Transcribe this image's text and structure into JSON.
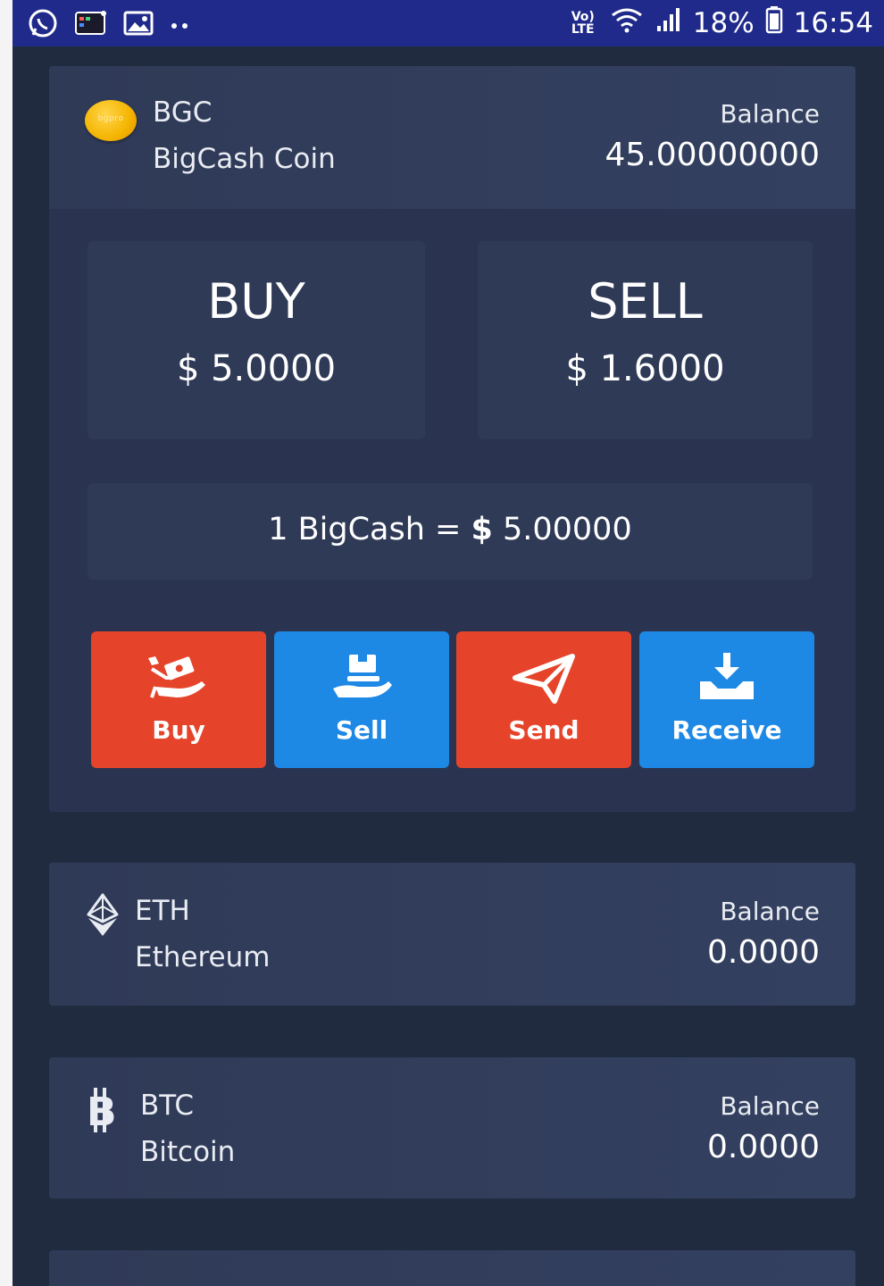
{
  "status_bar": {
    "left_icons": [
      "whatsapp-icon",
      "app-notification-icon",
      "gallery-icon",
      "more-dots-icon"
    ],
    "network_label": "Vo) LTE",
    "battery_percent": "18%",
    "time": "16:54"
  },
  "main_coin": {
    "symbol": "BGC",
    "name": "BigCash Coin",
    "logo_text": "bgpro",
    "balance_label": "Balance",
    "balance_value": "45.00000000",
    "buy_title": "BUY",
    "buy_price": "$ 5.0000",
    "sell_title": "SELL",
    "sell_price": "$ 1.6000",
    "rate_prefix": "1 BigCash = ",
    "rate_dollar": "$",
    "rate_value": " 5.00000",
    "actions": [
      {
        "label": "Buy",
        "icon": "hand-money-icon",
        "color": "#e5442b"
      },
      {
        "label": "Sell",
        "icon": "hand-box-icon",
        "color": "#1e88e5"
      },
      {
        "label": "Send",
        "icon": "paper-plane-icon",
        "color": "#e5442b"
      },
      {
        "label": "Receive",
        "icon": "download-tray-icon",
        "color": "#1e88e5"
      }
    ]
  },
  "coins": [
    {
      "symbol": "ETH",
      "name": "Ethereum",
      "icon": "ethereum-icon",
      "balance_label": "Balance",
      "balance_value": "0.0000"
    },
    {
      "symbol": "BTC",
      "name": "Bitcoin",
      "icon": "bitcoin-icon",
      "balance_label": "Balance",
      "balance_value": "0.0000"
    }
  ]
}
